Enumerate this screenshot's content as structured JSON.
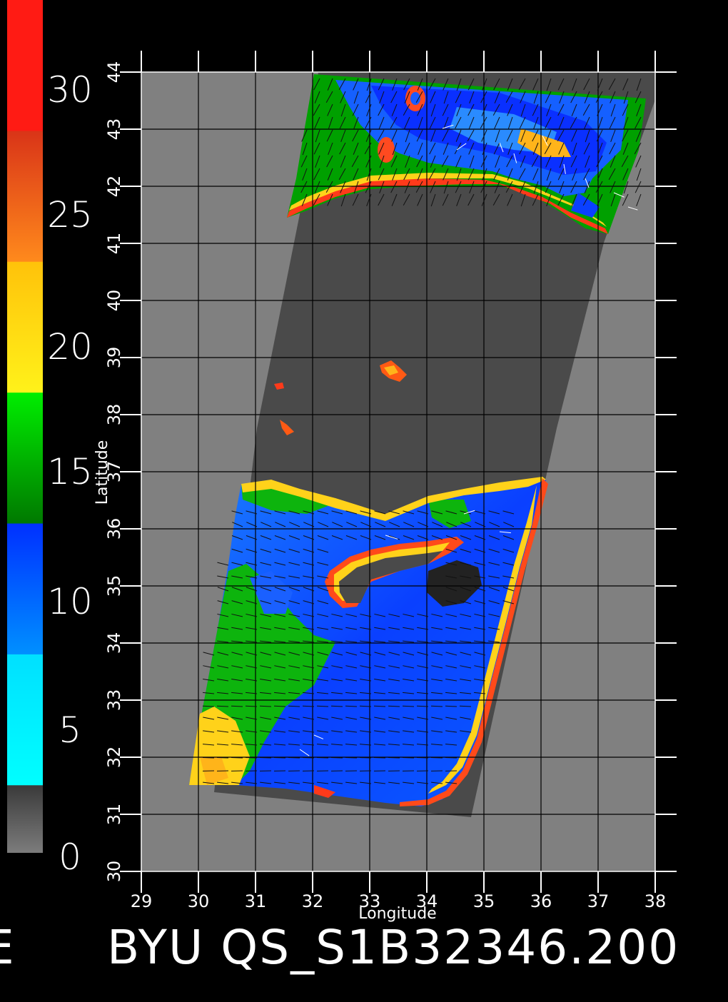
{
  "colorbar": {
    "labels": [
      "30",
      "25",
      "20",
      "15",
      "10",
      "5",
      "0"
    ],
    "segments": [
      {
        "label": "30",
        "from_color": "#ff1b14",
        "to_color": "#ff1b14"
      },
      {
        "label": "25",
        "from_color": "#d93418",
        "to_color": "#ff8a1c"
      },
      {
        "label": "20",
        "from_color": "#ffc20a",
        "to_color": "#fff21a"
      },
      {
        "label": "15",
        "from_color": "#00ee00",
        "to_color": "#007800"
      },
      {
        "label": "10",
        "from_color": "#0030ff",
        "to_color": "#0090ff"
      },
      {
        "label": "5",
        "from_color": "#00e0ff",
        "to_color": "#00ffff"
      },
      {
        "label": "0",
        "from_color": "#3a3a3a",
        "to_color": "#7c7c7c"
      }
    ]
  },
  "axes": {
    "xlabel": "Longitude",
    "ylabel": "Latitude",
    "xlim": [
      29,
      38
    ],
    "ylim": [
      30,
      44
    ],
    "x_ticks": [
      "29",
      "30",
      "31",
      "32",
      "33",
      "34",
      "35",
      "36",
      "37",
      "38"
    ],
    "y_ticks": [
      "30",
      "31",
      "32",
      "33",
      "34",
      "35",
      "36",
      "37",
      "38",
      "39",
      "40",
      "41",
      "42",
      "43",
      "44"
    ]
  },
  "map": {
    "background_color": "#808080",
    "swath_color": "#4a4a4a",
    "land_mask_color": "#4a4a4a"
  },
  "footer": {
    "left_fragment": "E",
    "title": "BYU QS_S1B32346.200"
  }
}
